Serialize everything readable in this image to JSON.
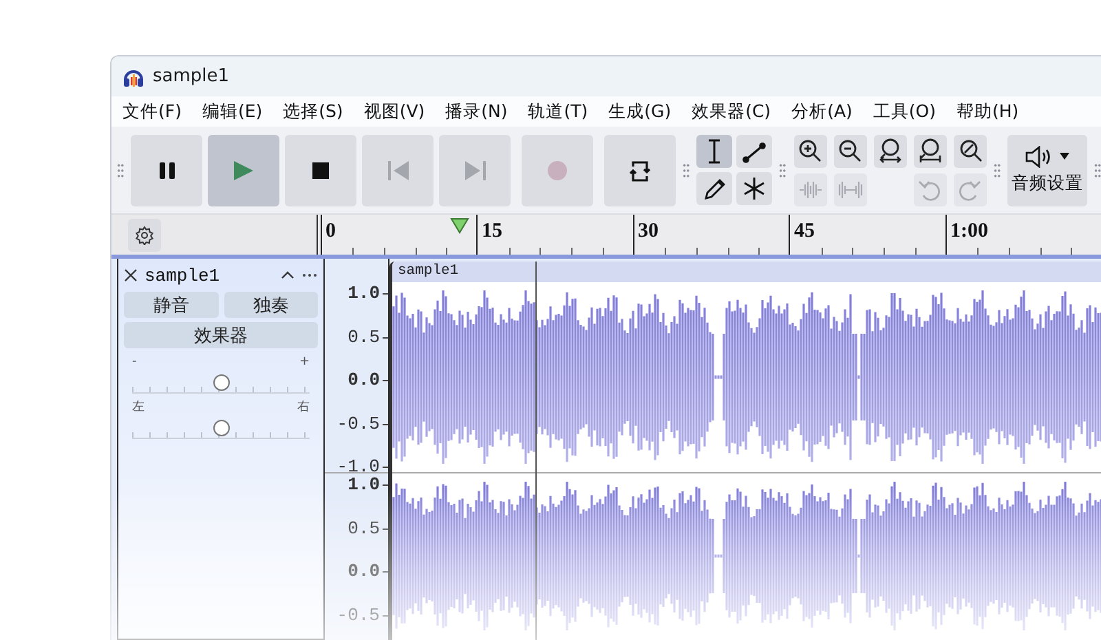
{
  "window": {
    "title": "sample1"
  },
  "menu": [
    "文件(F)",
    "编辑(E)",
    "选择(S)",
    "视图(V)",
    "播录(N)",
    "轨道(T)",
    "生成(G)",
    "效果器(C)",
    "分析(A)",
    "工具(O)",
    "帮助(H)"
  ],
  "transport": [
    {
      "kind": "pause",
      "pressed": false,
      "disabled": false
    },
    {
      "kind": "play",
      "pressed": true,
      "disabled": false
    },
    {
      "kind": "stop",
      "pressed": false,
      "disabled": false
    },
    {
      "kind": "skip-start",
      "pressed": false,
      "disabled": true
    },
    {
      "kind": "skip-end",
      "pressed": false,
      "disabled": true
    },
    {
      "kind": "record",
      "pressed": false,
      "disabled": true
    },
    {
      "kind": "loop",
      "pressed": false,
      "disabled": false
    }
  ],
  "tools": [
    {
      "kind": "select",
      "selected": true
    },
    {
      "kind": "envelope",
      "selected": false
    },
    {
      "kind": "draw",
      "selected": false
    },
    {
      "kind": "multi",
      "selected": false
    }
  ],
  "view_tools": [
    {
      "kind": "zoom-in",
      "disabled": false
    },
    {
      "kind": "zoom-out",
      "disabled": false
    },
    {
      "kind": "fit-selection",
      "disabled": false
    },
    {
      "kind": "fit-project",
      "disabled": false
    },
    {
      "kind": "zoom-toggle",
      "disabled": false
    },
    {
      "kind": "trim",
      "disabled": true
    },
    {
      "kind": "silence",
      "disabled": true
    },
    {
      "kind": "undo",
      "disabled": true
    },
    {
      "kind": "redo",
      "disabled": true
    }
  ],
  "audio_setup": {
    "label": "音频设置"
  },
  "ruler": {
    "labels": [
      "0",
      "15",
      "30",
      "45",
      "1:00"
    ]
  },
  "track": {
    "name": "sample1",
    "mute": "静音",
    "solo": "独奏",
    "effects": "效果器",
    "gain": {
      "min_label": "-",
      "max_label": "+",
      "level": 0.5
    },
    "pan": {
      "min_label": "左",
      "max_label": "右",
      "level": 0.5
    },
    "clip_title": "sample1",
    "channels": [
      {
        "scale": [
          "1.0",
          "0.5",
          "0.0",
          "-0.5",
          "-1.0"
        ]
      },
      {
        "scale": [
          "1.0",
          "0.5",
          "0.0",
          "-0.5"
        ]
      }
    ]
  }
}
